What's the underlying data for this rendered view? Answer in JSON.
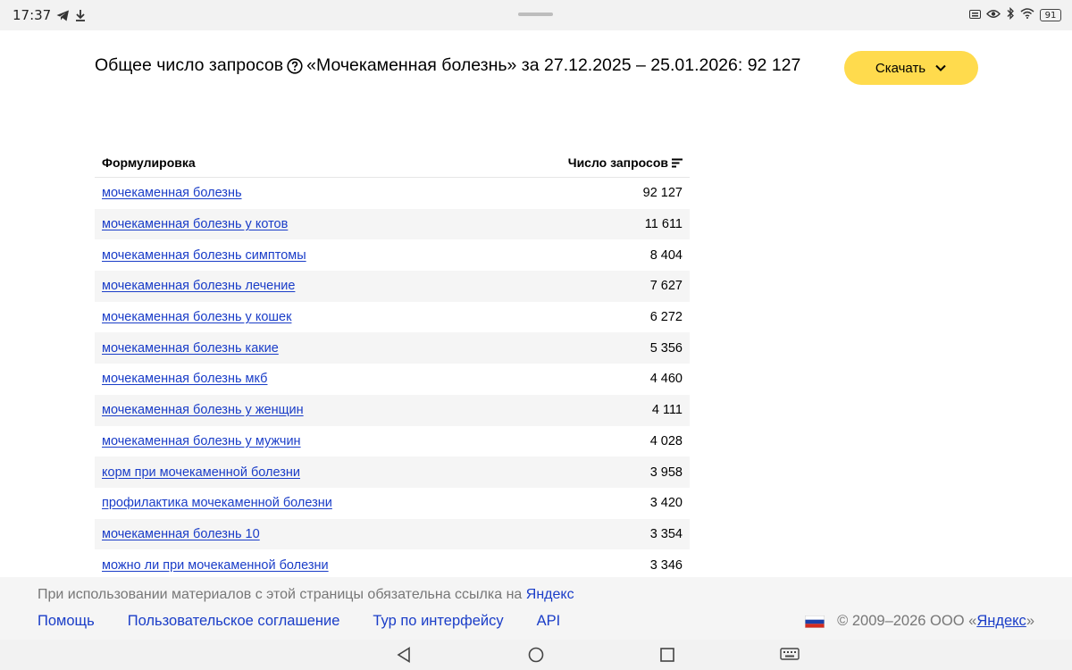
{
  "status_bar": {
    "time": "17:37",
    "battery": "91",
    "icons_left": [
      "telegram-icon",
      "download-icon"
    ],
    "icons_right": [
      "keyboard-icon",
      "eye-icon",
      "bluetooth-icon",
      "wifi-icon",
      "battery-icon"
    ]
  },
  "header": {
    "title_prefix": "Общее число запросов",
    "title_suffix": "«Мочекаменная болезнь» за 27.12.2025 – 25.01.2026: 92 127",
    "download_label": "Скачать"
  },
  "table": {
    "columns": [
      "Формулировка",
      "Число запросов"
    ],
    "rows": [
      {
        "phrase": "мочекаменная болезнь",
        "count": "92 127"
      },
      {
        "phrase": "мочекаменная болезнь у котов",
        "count": "11 611"
      },
      {
        "phrase": "мочекаменная болезнь симптомы",
        "count": "8 404"
      },
      {
        "phrase": "мочекаменная болезнь лечение",
        "count": "7 627"
      },
      {
        "phrase": "мочекаменная болезнь у кошек",
        "count": "6 272"
      },
      {
        "phrase": "мочекаменная болезнь какие",
        "count": "5 356"
      },
      {
        "phrase": "мочекаменная болезнь мкб",
        "count": "4 460"
      },
      {
        "phrase": "мочекаменная болезнь у женщин",
        "count": "4 111"
      },
      {
        "phrase": "мочекаменная болезнь у мужчин",
        "count": "4 028"
      },
      {
        "phrase": "корм при мочекаменной болезни",
        "count": "3 958"
      },
      {
        "phrase": "профилактика мочекаменной болезни",
        "count": "3 420"
      },
      {
        "phrase": "мочекаменная болезнь 10",
        "count": "3 354"
      },
      {
        "phrase": "можно ли при мочекаменной болезни",
        "count": "3 346"
      }
    ]
  },
  "footer": {
    "note_text": "При использовании материалов с этой страницы обязательна ссылка на",
    "note_link": "Яндекс",
    "links": [
      "Помощь",
      "Пользовательское соглашение",
      "Тур по интерфейсу",
      "API"
    ],
    "copyright_prefix": "© 2009–2026  ООО «",
    "copyright_link": "Яндекс",
    "copyright_suffix": "»"
  },
  "colors": {
    "accent": "#ffdb4d",
    "link": "#1a3dc8",
    "row_alt": "#f5f5f5"
  }
}
